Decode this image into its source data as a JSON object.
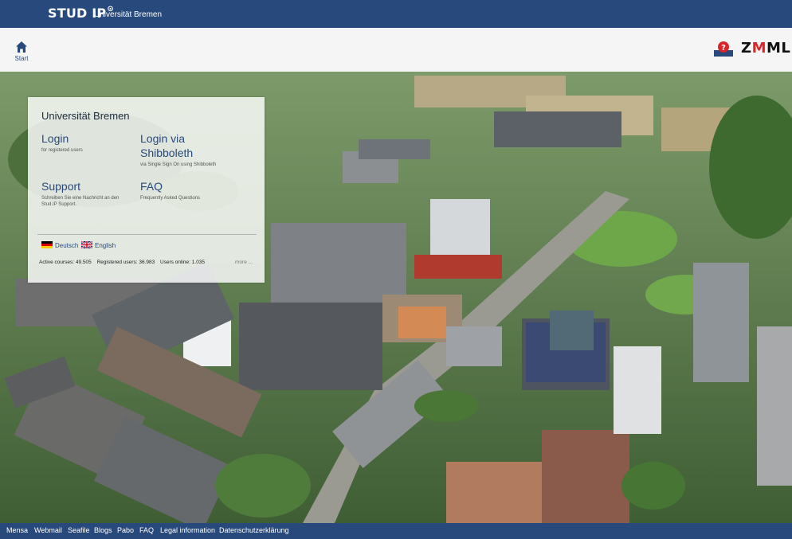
{
  "header": {
    "logo": "STUD IP",
    "university": "Universität Bremen"
  },
  "nav": {
    "start_label": "Start",
    "brand_right": "ZMML"
  },
  "login_box": {
    "title": "Universität Bremen",
    "login": {
      "label": "Login",
      "subtitle": "for registered users"
    },
    "shibboleth": {
      "label_line1": "Login via",
      "label_line2": "Shibboleth",
      "subtitle": "via Single Sign On using Shibboleth"
    },
    "support": {
      "label": "Support",
      "subtitle_line1": "Schreiben Sie eine Nachricht an den",
      "subtitle_line2": "Stud.IP Support."
    },
    "faq": {
      "label": "FAQ",
      "subtitle": "Frequently Asked Questions"
    },
    "languages": [
      "Deutsch",
      "English"
    ],
    "stats": {
      "active_courses": "Active courses: 49.505",
      "registered_users": "Registered users: 36.983",
      "users_online": "Users online: 1.035"
    },
    "more": "more ..."
  },
  "footer": {
    "links": [
      "Mensa",
      "Webmail",
      "Seafile",
      "Blogs",
      "Pabo",
      "FAQ",
      "Legal information",
      "Datenschutzerklärung"
    ]
  },
  "colors": {
    "brand_blue": "#28497c",
    "zmml_red": "#d9262b"
  }
}
